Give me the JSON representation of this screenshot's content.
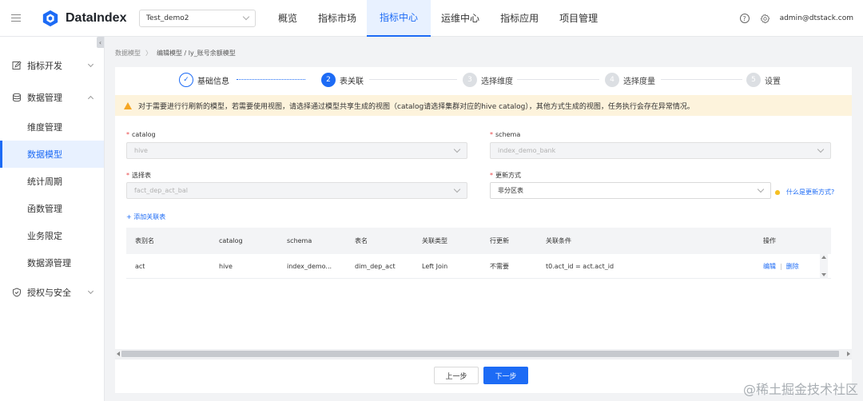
{
  "header": {
    "app_name": "DataIndex",
    "project": "Test_demo2",
    "nav": [
      {
        "label": "概览"
      },
      {
        "label": "指标市场"
      },
      {
        "label": "指标中心"
      },
      {
        "label": "运维中心"
      },
      {
        "label": "指标应用"
      },
      {
        "label": "项目管理"
      }
    ],
    "active_nav": "指标中心",
    "help_glyph": "?",
    "user": "admin@dtstack.com"
  },
  "sidebar": {
    "collapse_glyph": "‹",
    "groups": [
      {
        "label": "指标开发",
        "icon": "edit-icon"
      },
      {
        "label": "数据管理",
        "icon": "database-icon"
      },
      {
        "label": "授权与安全",
        "icon": "shield-icon"
      }
    ],
    "sub_items": [
      {
        "label": "维度管理"
      },
      {
        "label": "数据模型"
      },
      {
        "label": "统计周期"
      },
      {
        "label": "函数管理"
      },
      {
        "label": "业务限定"
      },
      {
        "label": "数据源管理"
      }
    ],
    "active_item": "数据模型"
  },
  "breadcrumb": {
    "root": "数据模型",
    "sep": "〉",
    "current": "编辑模型 / ly_账号余额模型"
  },
  "steps": [
    {
      "num": "✓",
      "label": "基础信息",
      "state": "done"
    },
    {
      "num": "2",
      "label": "表关联",
      "state": "current"
    },
    {
      "num": "3",
      "label": "选择维度",
      "state": "todo"
    },
    {
      "num": "4",
      "label": "选择度量",
      "state": "todo"
    },
    {
      "num": "5",
      "label": "设置",
      "state": "todo"
    }
  ],
  "warning": "对于需要进行行刷新的模型，若需要使用视图，请选择通过模型共享生成的视图（catalog请选择集群对应的hive catalog），其他方式生成的视图，任务执行会存在异常情况。",
  "form": {
    "required_mark": "*",
    "catalog_label": "catalog",
    "catalog_value": "hive",
    "schema_label": "schema",
    "schema_value": "index_demo_bank",
    "table_label": "选择表",
    "table_value": "fact_dep_act_bal",
    "update_label": "更新方式",
    "update_value": "非分区表",
    "update_hint": "什么是更新方式?",
    "add_relation": "+ 添加关联表"
  },
  "table": {
    "columns": [
      "表别名",
      "catalog",
      "schema",
      "表名",
      "关联类型",
      "行更新",
      "关联条件",
      "操作"
    ],
    "rows": [
      {
        "alias": "act",
        "catalog": "hive",
        "schema": "index_demo...",
        "table": "dim_dep_act",
        "join": "Left Join",
        "row_update": "不需要",
        "condition": "t0.act_id = act.act_id",
        "edit": "编辑",
        "op_sep": "|",
        "delete": "删除"
      }
    ]
  },
  "footer": {
    "prev": "上一步",
    "next": "下一步"
  },
  "watermark": "@稀土掘金技术社区",
  "colors": {
    "primary": "#1d6bf5",
    "warning_bg": "#fdf3dc",
    "warning_icon": "#f5a623",
    "required": "#e84749"
  }
}
